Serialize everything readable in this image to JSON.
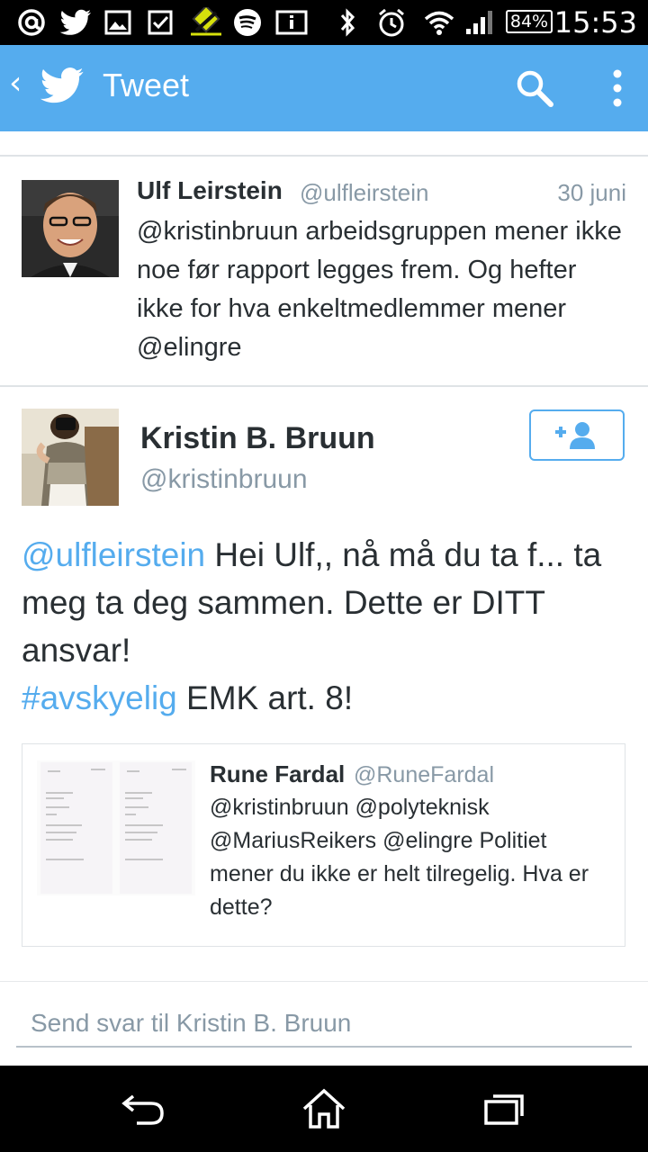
{
  "status_bar": {
    "battery": "84%",
    "time": "15:53",
    "icons": [
      "at-icon",
      "twitter-bird-icon",
      "image-icon",
      "checkbox-icon",
      "app-icon",
      "spotify-icon",
      "info-icon",
      "bluetooth-icon",
      "alarm-icon",
      "wifi-icon",
      "signal-icon"
    ]
  },
  "header": {
    "title": "Tweet",
    "accent_color": "#55acee"
  },
  "tweets": [
    {
      "name": "Ulf Leirstein",
      "handle": "@ulfleirstein",
      "date": "30 juni",
      "text": "@kristinbruun arbeidsgruppen mener ikke noe før rapport legges frem. Og hefter ikke for hva enkeltmedlemmer mener @elingre"
    },
    {
      "name": "Kristin B. Bruun",
      "handle": "@kristinbruun",
      "text_mention": "@ulfleirstein",
      "text_line1": " Hei Ulf,, nå må du ta f... ta meg ta deg sammen. Dette er DITT ansvar!",
      "text_hashtag": "#avskyelig",
      "text_line2": " EMK art. 8!",
      "quote": {
        "name": "Rune Fardal",
        "handle": "@RuneFardal",
        "text": "@kristinbruun @polyteknisk @MariusReikers @elingre Politiet mener du ikke er helt tilregelig. Hva er dette?"
      }
    }
  ],
  "reply": {
    "placeholder": "Send svar til Kristin B. Bruun"
  }
}
